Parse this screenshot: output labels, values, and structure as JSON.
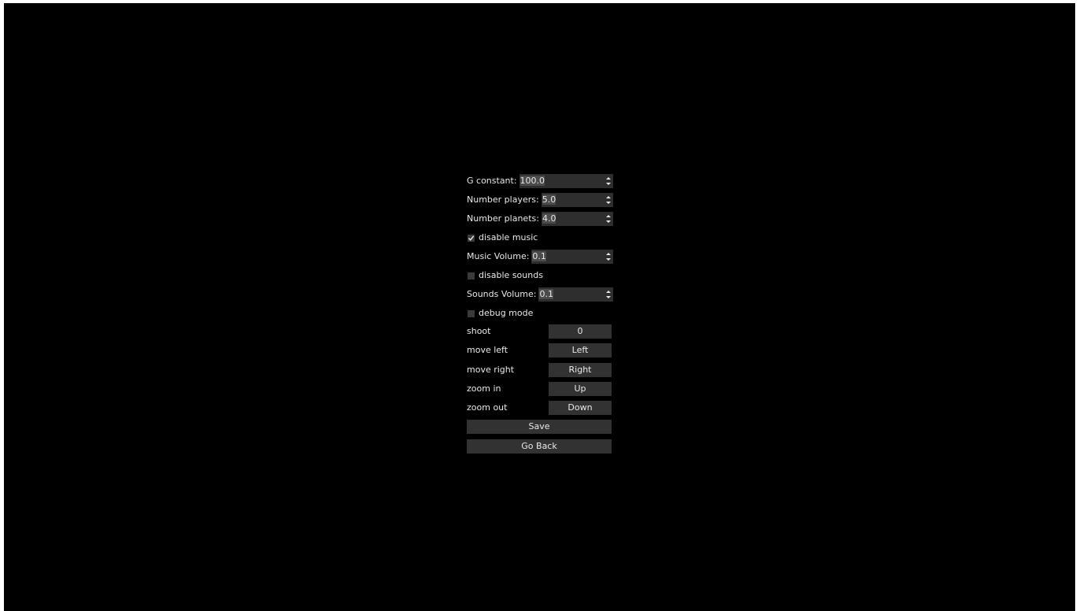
{
  "settings": {
    "g_constant": {
      "label": "G constant:",
      "value": "100.0"
    },
    "number_players": {
      "label": "Number players:",
      "value": "5.0"
    },
    "number_planets": {
      "label": "Number planets:",
      "value": "4.0"
    },
    "disable_music": {
      "label": "disable music",
      "checked": true
    },
    "music_volume": {
      "label": "Music Volume:",
      "value": "0.1"
    },
    "disable_sounds": {
      "label": "disable sounds",
      "checked": false
    },
    "sounds_volume": {
      "label": "Sounds Volume:",
      "value": "0.1"
    },
    "debug_mode": {
      "label": "debug mode",
      "checked": false
    }
  },
  "keybindings": [
    {
      "action": "shoot",
      "key": "0"
    },
    {
      "action": "move left",
      "key": "Left"
    },
    {
      "action": "move right",
      "key": "Right"
    },
    {
      "action": "zoom in",
      "key": "Up"
    },
    {
      "action": "zoom out",
      "key": "Down"
    }
  ],
  "buttons": {
    "save": "Save",
    "go_back": "Go Back"
  },
  "colors": {
    "background": "#000000",
    "control": "#2e2e2e",
    "text": "#e8e8e8"
  }
}
